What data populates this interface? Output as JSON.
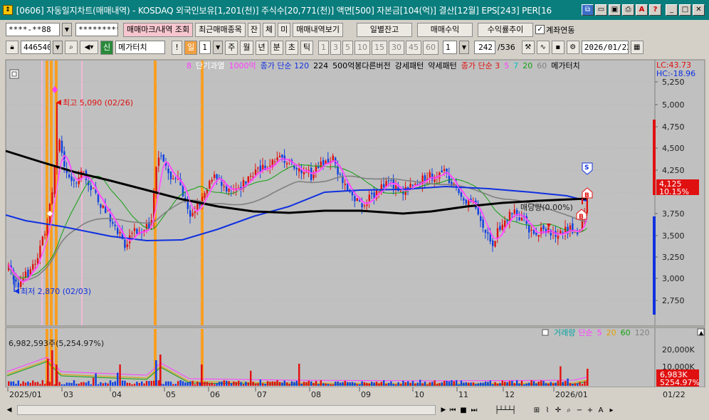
{
  "window": {
    "title": "[0606] 자동일지차트(매매내역) - KOSDAQ 외국인보유[1,201(천)] 주식수[20,771(천)] 액면[500] 자본금[104(억)] 결산[12월] EPS[243] PER[16"
  },
  "toolbar1": {
    "account": "****-**88",
    "password": "*********",
    "trade_mark_btn": "매매마크/내역 조회",
    "recent_btn": "최근매매종목",
    "b_jan": "잔",
    "b_che": "체",
    "b_mi": "미",
    "history_btn": "매매내역보기",
    "daily_balance_btn": "일별잔고",
    "trade_profit_btn": "매매수익",
    "yield_btn": "수익률추이",
    "link_label": "계좌연동",
    "link_checked": "✓"
  },
  "toolbar2": {
    "code": "446540",
    "sin": "신",
    "stock_name": "메가터치",
    "excl": "!",
    "period_day": "일",
    "period_num": "1",
    "p_week": "주",
    "p_month": "월",
    "p_year": "년",
    "p_min": "분",
    "p_tick_ch": "초",
    "p_tick": "틱",
    "intervals": [
      "1",
      "3",
      "5",
      "10",
      "15",
      "30",
      "45",
      "60"
    ],
    "interval_sel": "1",
    "count": "242",
    "total": "/536",
    "date": "2026/01/22"
  },
  "legend": {
    "items": [
      {
        "text": "8",
        "color": "#ff3cff"
      },
      {
        "text": "단기과열",
        "color": "#ffffff"
      },
      {
        "text": "1000억",
        "color": "#ff3cff"
      },
      {
        "text": "종가 단순 120",
        "color": "#1030e0"
      },
      {
        "text": "224",
        "color": "#000000"
      },
      {
        "text": "500억봉다른버전",
        "color": "#000000"
      },
      {
        "text": "강세패턴",
        "color": "#000000"
      },
      {
        "text": "약세패턴",
        "color": "#000000"
      },
      {
        "text": "종가 단순 3",
        "color": "#e01010"
      },
      {
        "text": "5",
        "color": "#ff3cff"
      },
      {
        "text": "7",
        "color": "#00c0c0"
      },
      {
        "text": "20",
        "color": "#10a010"
      },
      {
        "text": "60",
        "color": "#808080"
      },
      {
        "text": "메가터치",
        "color": "#000000"
      }
    ],
    "lc": "LC:43.73",
    "hc": "HC:-18.96"
  },
  "annotations": {
    "high": "최고 5,090 (02/26)",
    "low": "최저 2,870 (02/03)",
    "ratio": "매당량(0.00%)",
    "marker_s": "S",
    "marker_b": "B"
  },
  "price_axis": {
    "labels": [
      "5,250",
      "5,000",
      "4,750",
      "4,500",
      "4,250",
      "3,750",
      "3,500",
      "3,250",
      "3,000",
      "2,750"
    ],
    "current_price": "4,125",
    "change_pct": "10.15%"
  },
  "volume": {
    "legend_volume": "거래량",
    "legend_simple": "단순",
    "ma": [
      {
        "text": "5",
        "color": "#ff3cff"
      },
      {
        "text": "20",
        "color": "#e0a000"
      },
      {
        "text": "60",
        "color": "#10a010"
      },
      {
        "text": "120",
        "color": "#808080"
      }
    ],
    "top_label": "6,982,593주(5,254.97%)",
    "axis_labels": [
      "20,000K",
      "10,000K"
    ],
    "current": "6,983K",
    "current_pct": "5254.97%"
  },
  "time_axis": {
    "labels": [
      "2025/01",
      "03",
      "04",
      "05",
      "06",
      "07",
      "08",
      "09",
      "10",
      "11",
      "12",
      "2026/01"
    ],
    "right_label": "01/22"
  },
  "colors": {
    "chart_bg": "#c0c0c0",
    "up": "#e01010",
    "down": "#1040e0",
    "ma224": "#000000",
    "ma120": "#1030e0",
    "ma5": "#ff3cff",
    "ma60": "#808080",
    "ma20": "#10a010",
    "signal": "#ff9a10"
  }
}
